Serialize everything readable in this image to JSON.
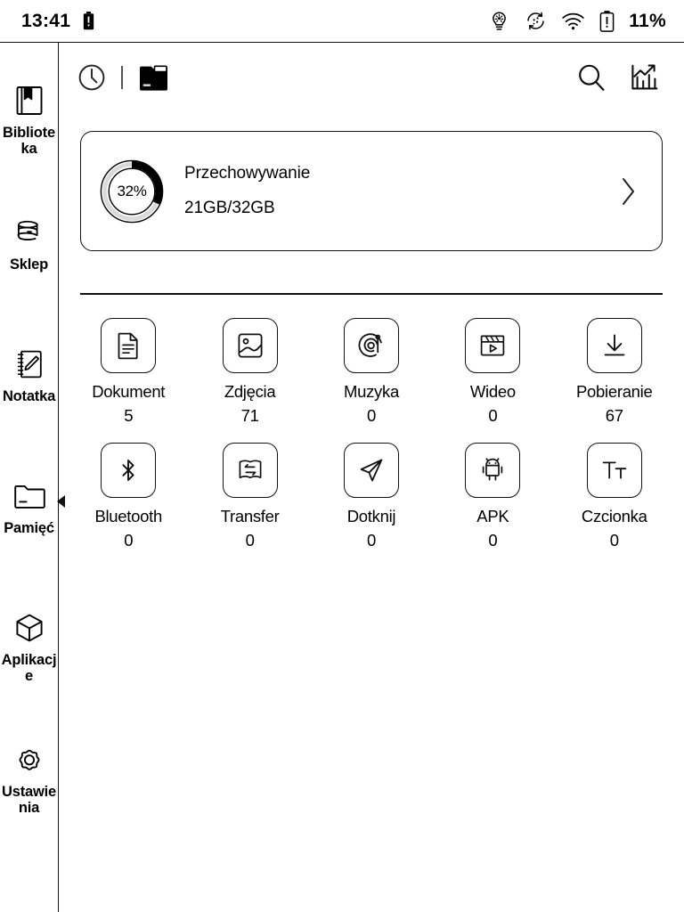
{
  "statusbar": {
    "time": "13:41",
    "battery_percent": "11%",
    "icons": {
      "battery_small": "battery-low-icon",
      "frontlight": "frontlight-bulb-icon",
      "refresh": "screen-refresh-icon",
      "wifi": "wifi-icon",
      "battery": "battery-warning-icon"
    }
  },
  "sidebar": {
    "items": [
      {
        "label": "Biblioteka",
        "icon": "library-book-icon",
        "selected": false
      },
      {
        "label": "Sklep",
        "icon": "store-books-icon",
        "selected": false
      },
      {
        "label": "Notatka",
        "icon": "notebook-pen-icon",
        "selected": false
      },
      {
        "label": "Pamięć",
        "icon": "storage-folder-icon",
        "selected": true
      },
      {
        "label": "Aplikacje",
        "icon": "apps-cube-icon",
        "selected": false
      },
      {
        "label": "Ustawienia",
        "icon": "settings-gear-icon",
        "selected": false
      }
    ]
  },
  "toolbar": {
    "recent_icon": "clock-recent-icon",
    "folder_icon": "folder-filled-icon",
    "search_icon": "search-icon",
    "analytics_icon": "storage-analytics-chart-icon"
  },
  "storage": {
    "percent_label": "32%",
    "percent_value": 32,
    "title": "Przechowywanie",
    "usage": "21GB/32GB",
    "chevron_icon": "chevron-right-icon"
  },
  "categories": [
    {
      "label": "Dokument",
      "count": "5",
      "icon": "document-icon"
    },
    {
      "label": "Zdjęcia",
      "count": "71",
      "icon": "image-icon"
    },
    {
      "label": "Muzyka",
      "count": "0",
      "icon": "music-vinyl-icon"
    },
    {
      "label": "Wideo",
      "count": "0",
      "icon": "video-clapperboard-icon"
    },
    {
      "label": "Pobieranie",
      "count": "67",
      "icon": "download-icon"
    },
    {
      "label": "Bluetooth",
      "count": "0",
      "icon": "bluetooth-icon"
    },
    {
      "label": "Transfer",
      "count": "0",
      "icon": "transfer-book-icon"
    },
    {
      "label": "Dotknij",
      "count": "0",
      "icon": "send-plane-icon"
    },
    {
      "label": "APK",
      "count": "0",
      "icon": "android-apk-icon"
    },
    {
      "label": "Czcionka",
      "count": "0",
      "icon": "font-tt-icon"
    }
  ],
  "colors": {
    "ink": "#000000",
    "background": "#ffffff",
    "track": "#d9d9d9"
  }
}
